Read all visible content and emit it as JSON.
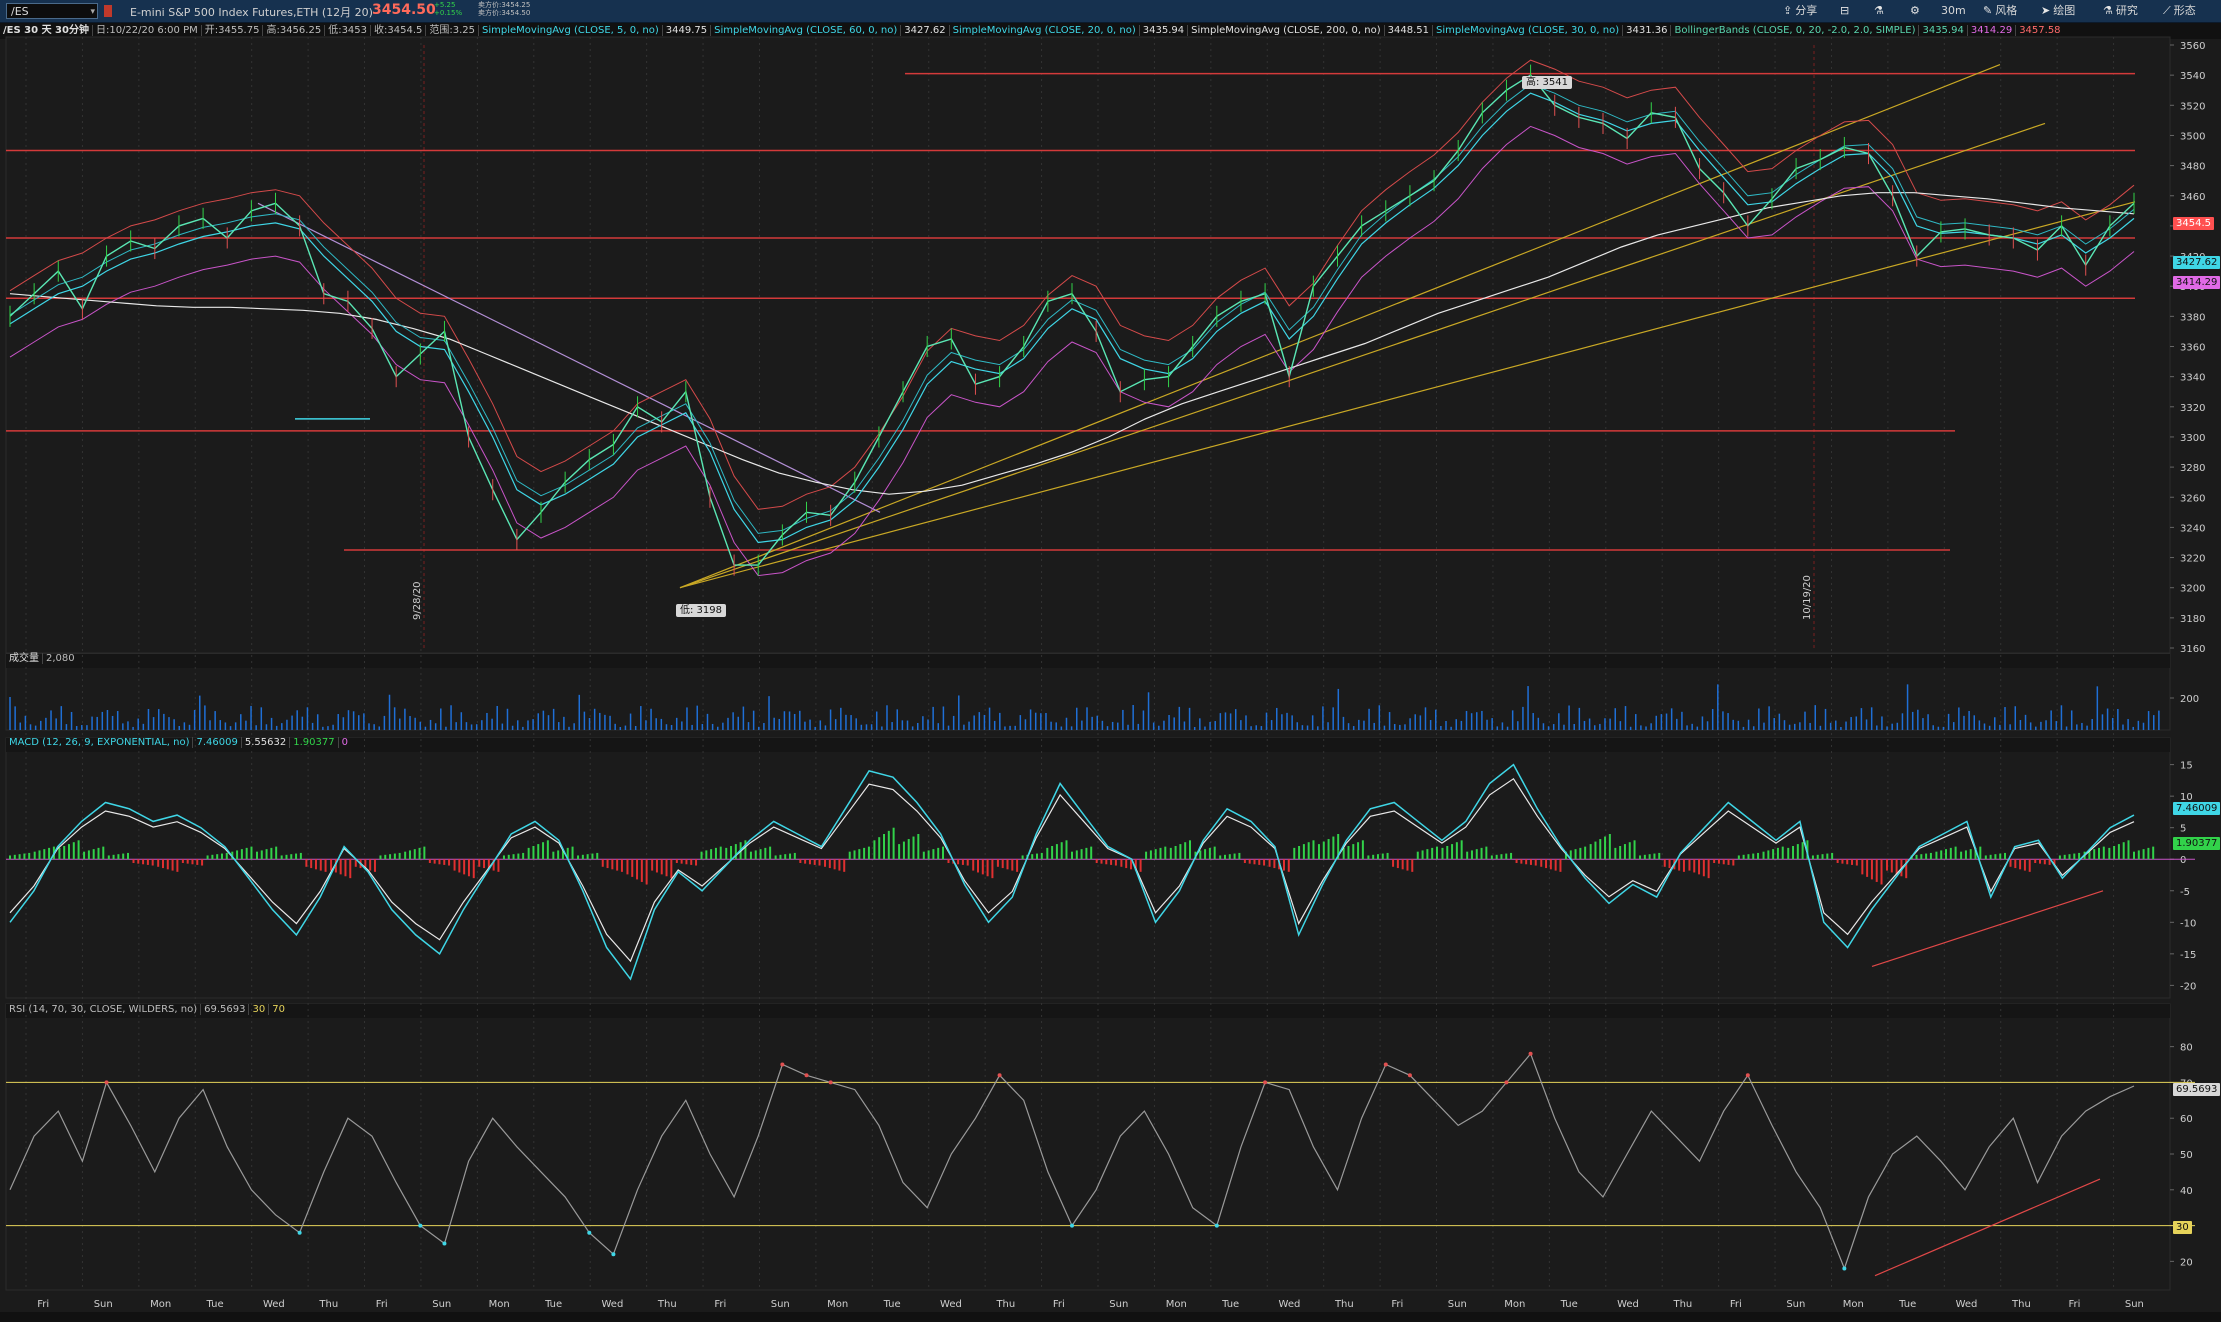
{
  "toolbar": {
    "symbol": "/ES",
    "instrument": "E-mini S&P 500 Index Futures,ETH (12月 20)",
    "price": "3454.50",
    "change_top": "+5.25",
    "change_bottom": "+0.15%",
    "bid": "卖方价:3454.25",
    "ask": "卖方价:3454.50",
    "buttons": [
      {
        "icon": "share-icon",
        "label": "分享"
      },
      {
        "icon": "layout-icon",
        "label": ""
      },
      {
        "icon": "beaker-icon",
        "label": ""
      },
      {
        "icon": "gear-icon",
        "label": ""
      },
      {
        "icon": "interval-icon",
        "label": "30m"
      },
      {
        "icon": "style-icon",
        "label": "风格"
      },
      {
        "icon": "cursor-icon",
        "label": "绘图"
      },
      {
        "icon": "flask-icon",
        "label": "研究"
      },
      {
        "icon": "pattern-icon",
        "label": "形态"
      }
    ]
  },
  "infobar": {
    "period": "/ES 30 天 30分钟",
    "date": "日:10/22/20 6:00 PM",
    "open": "开:3455.75",
    "high": "高:3456.25",
    "low": "低:3453",
    "close": "收:3454.5",
    "range": "范围:3.25",
    "studies": [
      {
        "name": "SimpleMovingAvg (CLOSE, 5, 0, no)",
        "value": "3449.75",
        "color": "#3fd6e6"
      },
      {
        "name": "SimpleMovingAvg (CLOSE, 60, 0, no)",
        "value": "3427.62",
        "color": "#3fd6e6"
      },
      {
        "name": "SimpleMovingAvg (CLOSE, 20, 0, no)",
        "value": "3435.94",
        "color": "#3fd6e6"
      },
      {
        "name": "SimpleMovingAvg (CLOSE, 200, 0, no)",
        "value": "3448.51",
        "color": "#e0e0e0"
      },
      {
        "name": "SimpleMovingAvg (CLOSE, 30, 0, no)",
        "value": "3431.36",
        "color": "#3fd6e6"
      },
      {
        "name": "BollingerBands (CLOSE, 0, 20, -2.0, 2.0, SIMPLE)",
        "value": "3435.94",
        "color": "#5ad6b0"
      }
    ],
    "bb_upper": "3414.29",
    "bb_lower": "3457.58"
  },
  "price_chart": {
    "ylim": [
      3160,
      3560
    ],
    "yticks": [
      "3560",
      "3540",
      "3520",
      "3500",
      "3480",
      "3460",
      "3440",
      "3420",
      "3400",
      "3380",
      "3360",
      "3340",
      "3320",
      "3300",
      "3280",
      "3260",
      "3240",
      "3220",
      "3200",
      "3180",
      "3160"
    ],
    "high_tag": "高: 3541",
    "low_tag": "低: 3198",
    "right_badges": [
      {
        "text": "3454.5",
        "color": "#ff5050",
        "value": 3454.5
      },
      {
        "text": "3427.62",
        "color": "#3fd6e6",
        "value": 3427.62
      },
      {
        "text": "3414.29",
        "color": "#e06ae6",
        "value": 3414.29
      }
    ],
    "series_close": [
      3380,
      3395,
      3410,
      3385,
      3420,
      3430,
      3425,
      3440,
      3445,
      3432,
      3450,
      3455,
      3440,
      3395,
      3390,
      3372,
      3340,
      3355,
      3370,
      3300,
      3265,
      3232,
      3250,
      3270,
      3285,
      3295,
      3320,
      3310,
      3330,
      3260,
      3215,
      3215,
      3235,
      3250,
      3248,
      3270,
      3300,
      3330,
      3360,
      3365,
      3335,
      3340,
      3360,
      3390,
      3395,
      3370,
      3330,
      3338,
      3340,
      3360,
      3380,
      3390,
      3395,
      3340,
      3400,
      3420,
      3440,
      3450,
      3460,
      3470,
      3490,
      3515,
      3530,
      3540,
      3520,
      3512,
      3508,
      3498,
      3515,
      3512,
      3478,
      3462,
      3440,
      3458,
      3478,
      3484,
      3492,
      3488,
      3460,
      3420,
      3436,
      3438,
      3434,
      3432,
      3424,
      3440,
      3414,
      3440,
      3455
    ],
    "series_ma": [
      3375,
      3385,
      3395,
      3400,
      3410,
      3418,
      3422,
      3428,
      3433,
      3436,
      3440,
      3442,
      3438,
      3420,
      3405,
      3390,
      3370,
      3360,
      3358,
      3330,
      3300,
      3265,
      3255,
      3262,
      3272,
      3282,
      3300,
      3308,
      3316,
      3290,
      3252,
      3230,
      3232,
      3240,
      3245,
      3258,
      3280,
      3305,
      3335,
      3350,
      3345,
      3342,
      3352,
      3372,
      3385,
      3378,
      3352,
      3345,
      3342,
      3352,
      3370,
      3382,
      3390,
      3365,
      3380,
      3405,
      3428,
      3442,
      3454,
      3465,
      3480,
      3500,
      3516,
      3528,
      3522,
      3514,
      3510,
      3503,
      3508,
      3510,
      3490,
      3472,
      3454,
      3456,
      3468,
      3478,
      3487,
      3488,
      3472,
      3440,
      3435,
      3436,
      3434,
      3432,
      3428,
      3434,
      3422,
      3432,
      3445
    ],
    "series_200": [
      3395,
      3393,
      3391,
      3389,
      3387,
      3386,
      3386,
      3385,
      3384,
      3382,
      3378,
      3372,
      3365,
      3355,
      3345,
      3335,
      3325,
      3315,
      3305,
      3295,
      3285,
      3276,
      3270,
      3265,
      3262,
      3264,
      3268,
      3275,
      3282,
      3290,
      3300,
      3312,
      3322,
      3330,
      3338,
      3346,
      3354,
      3362,
      3372,
      3382,
      3390,
      3398,
      3406,
      3416,
      3426,
      3434,
      3440,
      3446,
      3452,
      3456,
      3460,
      3462,
      3462,
      3460,
      3458,
      3455,
      3452,
      3450,
      3448
    ],
    "hlines": [
      3541,
      3490,
      3432,
      3392,
      3304,
      3225
    ],
    "channel_top_start": [
      3450,
      3500
    ],
    "trend_top": "3450 → 3400"
  },
  "volume_panel": {
    "label": "成交量",
    "value": "2,080",
    "yticks": [
      "200"
    ]
  },
  "macd_panel": {
    "label": "MACD (12, 26, 9, EXPONENTIAL, no)",
    "value": "7.46009",
    "avg": "5.55632",
    "diff": "1.90377",
    "zero": "0",
    "ylim": [
      -22,
      17
    ],
    "yticks": [
      "15",
      "10",
      "5",
      "0",
      "-5",
      "-10",
      "-15",
      "-20"
    ],
    "badges": [
      {
        "text": "7.46009",
        "color": "#3fd6e6"
      },
      {
        "text": "1.90377",
        "color": "#32d24a"
      }
    ],
    "series": [
      -10,
      -5,
      2,
      6,
      9,
      8,
      6,
      7,
      5,
      2,
      -3,
      -8,
      -12,
      -6,
      2,
      -2,
      -8,
      -12,
      -15,
      -8,
      -2,
      4,
      6,
      3,
      -5,
      -14,
      -19,
      -8,
      -2,
      -5,
      -1,
      3,
      6,
      4,
      2,
      8,
      14,
      13,
      9,
      4,
      -4,
      -10,
      -6,
      4,
      12,
      7,
      2,
      0,
      -10,
      -5,
      3,
      8,
      6,
      2,
      -12,
      -4,
      3,
      8,
      9,
      6,
      3,
      6,
      12,
      15,
      8,
      2,
      -3,
      -7,
      -4,
      -6,
      1,
      5,
      9,
      6,
      3,
      6,
      -10,
      -14,
      -8,
      -3,
      2,
      4,
      6,
      -6,
      2,
      3,
      -3,
      1,
      5,
      7
    ],
    "hist": [
      1,
      2,
      3,
      2,
      1,
      -1,
      -2,
      -1,
      1,
      2,
      2,
      1,
      -2,
      -3,
      -2,
      1,
      2,
      -1,
      -3,
      -2,
      1,
      3,
      2,
      1,
      -2,
      -4,
      -3,
      -1,
      2,
      3,
      2,
      1,
      -1,
      -2,
      2,
      5,
      4,
      2,
      -1,
      -3,
      -2,
      1,
      3,
      2,
      -1,
      -2,
      2,
      3,
      2,
      1,
      -1,
      -2,
      3,
      4,
      3,
      1,
      -2,
      2,
      3,
      2,
      1,
      -1,
      -2,
      2,
      4,
      3,
      1,
      -2,
      -3,
      -1,
      1,
      2,
      3,
      1,
      -1,
      -4,
      -3,
      1,
      2,
      2,
      1,
      -2,
      -1,
      1,
      2,
      3,
      2
    ]
  },
  "rsi_panel": {
    "label": "RSI (14, 70, 30, CLOSE, WILDERS, no)",
    "value": "69.5693",
    "low": "30",
    "high": "70",
    "ylim": [
      12,
      88
    ],
    "yticks": [
      "80",
      "70",
      "60",
      "50",
      "40",
      "30",
      "20"
    ],
    "badges": [
      {
        "text": "69.5693",
        "color": "#d8d8d8"
      },
      {
        "text": "30",
        "color": "#e6d35a"
      }
    ],
    "series": [
      40,
      55,
      62,
      48,
      70,
      58,
      45,
      60,
      68,
      52,
      40,
      33,
      28,
      45,
      60,
      55,
      42,
      30,
      25,
      48,
      60,
      52,
      45,
      38,
      28,
      22,
      40,
      55,
      65,
      50,
      38,
      55,
      75,
      72,
      70,
      68,
      58,
      42,
      35,
      50,
      60,
      72,
      65,
      45,
      30,
      40,
      55,
      62,
      50,
      35,
      30,
      52,
      70,
      68,
      52,
      40,
      60,
      75,
      72,
      65,
      58,
      62,
      70,
      78,
      60,
      45,
      38,
      50,
      62,
      55,
      48,
      62,
      72,
      58,
      45,
      35,
      18,
      38,
      50,
      55,
      48,
      40,
      52,
      60,
      42,
      55,
      62,
      66,
      69
    ]
  },
  "x_axis": {
    "days": [
      "Fri",
      "Sun",
      "Mon",
      "Tue",
      "Wed",
      "Thu",
      "Fri",
      "Sun",
      "Mon",
      "Tue",
      "Wed",
      "Thu",
      "Fri",
      "Sun",
      "Mon",
      "Tue",
      "Wed",
      "Thu",
      "Fri",
      "Sun",
      "Mon",
      "Tue",
      "Wed",
      "Thu",
      "Fri",
      "Sun",
      "Mon",
      "Tue",
      "Wed",
      "Thu",
      "Fri",
      "Sun",
      "Mon",
      "Tue",
      "Wed",
      "Thu",
      "Fri",
      "Sun"
    ],
    "vertical_marks": [
      "9/28/20",
      "10/19/20"
    ]
  }
}
